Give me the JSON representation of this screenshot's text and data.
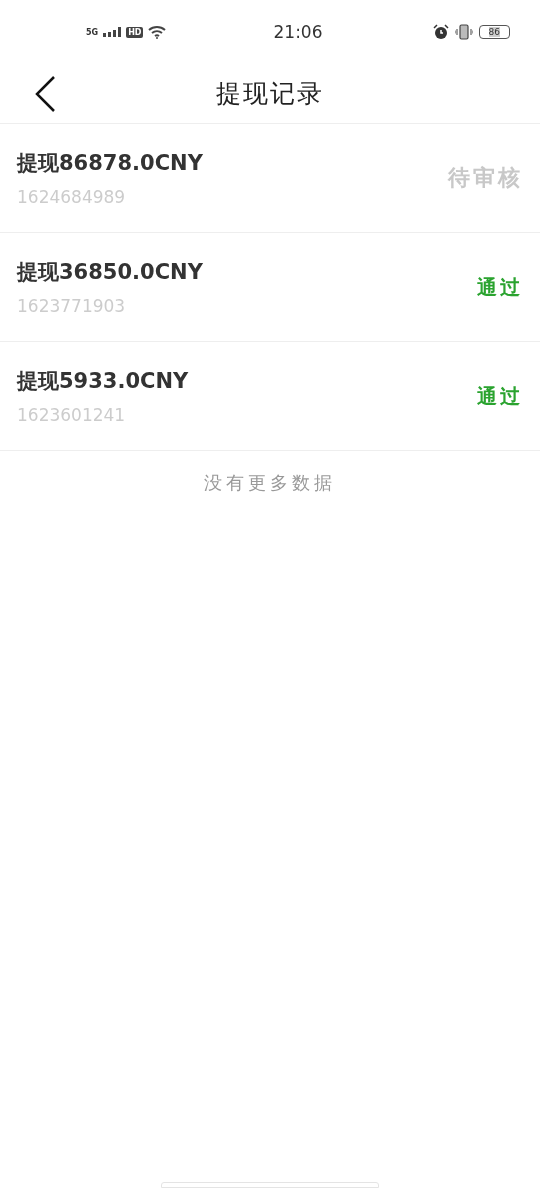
{
  "status_bar": {
    "network": "5G",
    "hd": "HD",
    "time": "21:06",
    "battery": "86"
  },
  "header": {
    "title": "提现记录"
  },
  "records": [
    {
      "title": "提现86878.0CNY",
      "timestamp": "1624684989",
      "status": {
        "label": "待审核",
        "kind": "pending"
      }
    },
    {
      "title": "提现36850.0CNY",
      "timestamp": "1623771903",
      "status": {
        "label": "通过",
        "kind": "approved"
      }
    },
    {
      "title": "提现5933.0CNY",
      "timestamp": "1623601241",
      "status": {
        "label": "通过",
        "kind": "approved"
      }
    }
  ],
  "footer": "没有更多数据"
}
